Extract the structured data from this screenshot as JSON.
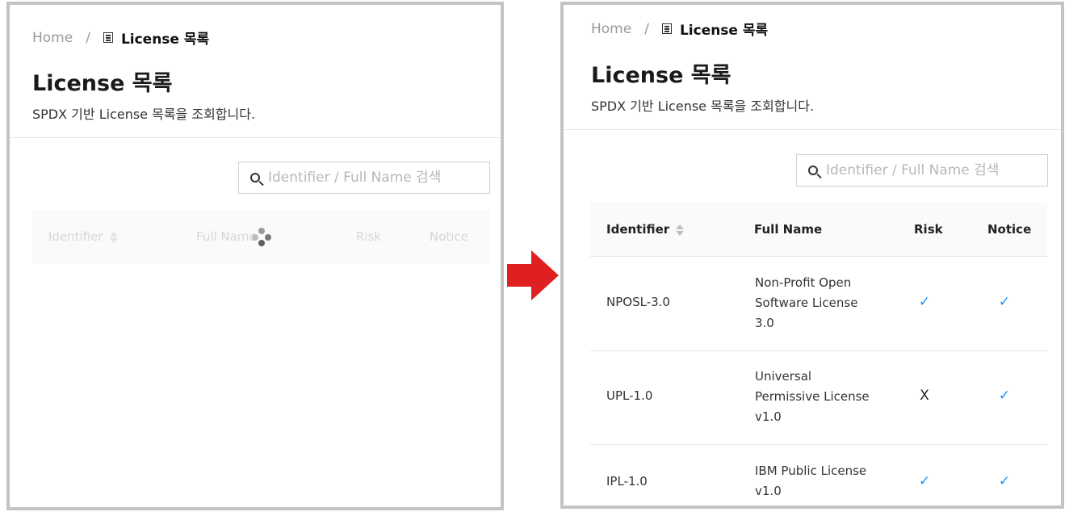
{
  "breadcrumb": {
    "home": "Home",
    "separator": "/",
    "current": "License 목록"
  },
  "page": {
    "title": "License 목록",
    "description": "SPDX 기반 License 목록을 조회합니다."
  },
  "search": {
    "placeholder": "Identifier / Full Name 검색"
  },
  "table": {
    "columns": [
      "Identifier",
      "Full Name",
      "Risk",
      "Notice"
    ],
    "rows": [
      {
        "identifier": "NPOSL-3.0",
        "full_name_lines": [
          "Non-Profit Open",
          "Software License",
          "3.0"
        ],
        "risk": "✓",
        "notice": "✓"
      },
      {
        "identifier": "UPL-1.0",
        "full_name_lines": [
          "Universal",
          "Permissive License",
          "v1.0"
        ],
        "risk": "X",
        "notice": "✓"
      },
      {
        "identifier": "IPL-1.0",
        "full_name_lines": [
          "IBM Public License",
          "v1.0"
        ],
        "risk": "✓",
        "notice": "✓"
      }
    ]
  },
  "colors": {
    "accent": "#1890ff",
    "arrow": "#e02020",
    "frame": "#c4c4c4"
  },
  "states": {
    "left": "loading",
    "right": "loaded"
  }
}
